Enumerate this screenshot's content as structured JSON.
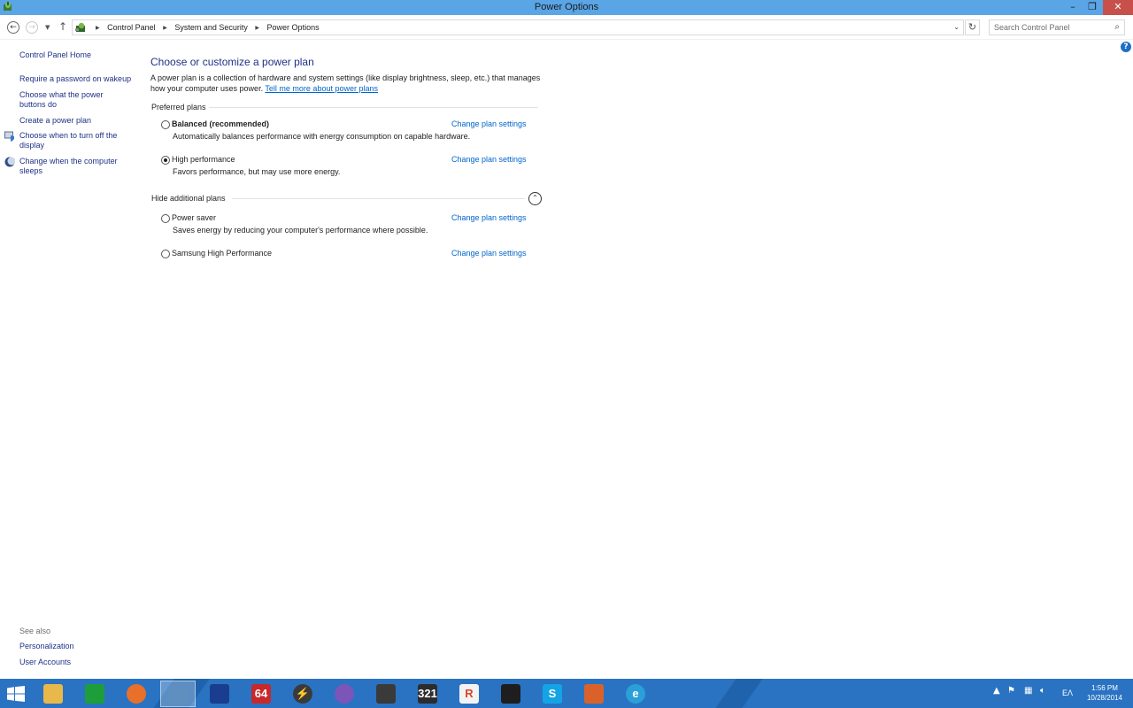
{
  "window": {
    "title": "Power Options",
    "minimize_glyph": "–",
    "maximize_glyph": "❐",
    "close_glyph": "✕"
  },
  "navigation": {
    "breadcrumbs": [
      "Control Panel",
      "System and Security",
      "Power Options"
    ],
    "search_placeholder": "Search Control Panel"
  },
  "left_pane": {
    "home_link": "Control Panel Home",
    "tasks": [
      {
        "label": "Require a password on wakeup",
        "icon": "none"
      },
      {
        "label": "Choose what the power buttons do",
        "icon": "none"
      },
      {
        "label": "Create a power plan",
        "icon": "none"
      },
      {
        "label": "Choose when to turn off the display",
        "icon": "monitor-shield-icon"
      },
      {
        "label": "Change when the computer sleeps",
        "icon": "moon-icon"
      }
    ],
    "see_also_label": "See also",
    "see_also": [
      "Personalization",
      "User Accounts"
    ]
  },
  "main": {
    "heading": "Choose or customize a power plan",
    "description": "A power plan is a collection of hardware and system settings (like display brightness, sleep, etc.) that manages how your computer uses power.",
    "learn_more_link": "Tell me more about power plans",
    "preferred_label": "Preferred plans",
    "additional_label": "Hide additional plans",
    "change_settings_label": "Change plan settings",
    "plans": [
      {
        "name": "Balanced (recommended)",
        "description": "Automatically balances performance with energy consumption on capable hardware.",
        "selected": false,
        "bold": true
      },
      {
        "name": "High performance",
        "description": "Favors performance, but may use more energy.",
        "selected": true,
        "bold": false
      },
      {
        "name": "Power saver",
        "description": "Saves energy by reducing your computer's performance where possible.",
        "selected": false,
        "bold": false
      },
      {
        "name": "Samsung High Performance",
        "description": "",
        "selected": false,
        "bold": false
      }
    ]
  },
  "taskbar": {
    "apps": [
      {
        "name": "file-explorer-icon",
        "glyph": "",
        "color": "#e8b84a"
      },
      {
        "name": "store-icon",
        "glyph": "",
        "color": "#1e9e3a"
      },
      {
        "name": "firefox-icon",
        "glyph": "",
        "color": "#e8702a"
      },
      {
        "name": "control-panel-icon",
        "glyph": "",
        "color": "#5f8fbf"
      },
      {
        "name": "nero-icon",
        "glyph": "",
        "color": "#1a3d8f"
      },
      {
        "name": "aida64-icon",
        "glyph": "64",
        "color": "#c8282a"
      },
      {
        "name": "bolt-app-icon",
        "glyph": "⚡",
        "color": "#3a3a3a"
      },
      {
        "name": "viber-icon",
        "glyph": "",
        "color": "#7b55b8"
      },
      {
        "name": "pencil-app-icon",
        "glyph": "",
        "color": "#3a3a3a"
      },
      {
        "name": "video-app-icon",
        "glyph": "321",
        "color": "#2c2c2c"
      },
      {
        "name": "r-app-icon",
        "glyph": "R",
        "color": "#f3f3f3"
      },
      {
        "name": "x-app-icon",
        "glyph": "",
        "color": "#1e1e1e"
      },
      {
        "name": "skype-icon",
        "glyph": "S",
        "color": "#14a4e6"
      },
      {
        "name": "office-app-icon",
        "glyph": "",
        "color": "#d9622a"
      },
      {
        "name": "internet-explorer-icon",
        "glyph": "e",
        "color": "#2a9fd8"
      }
    ],
    "language": "EΛ",
    "time": "1:56 PM",
    "date": "10/28/2014"
  }
}
